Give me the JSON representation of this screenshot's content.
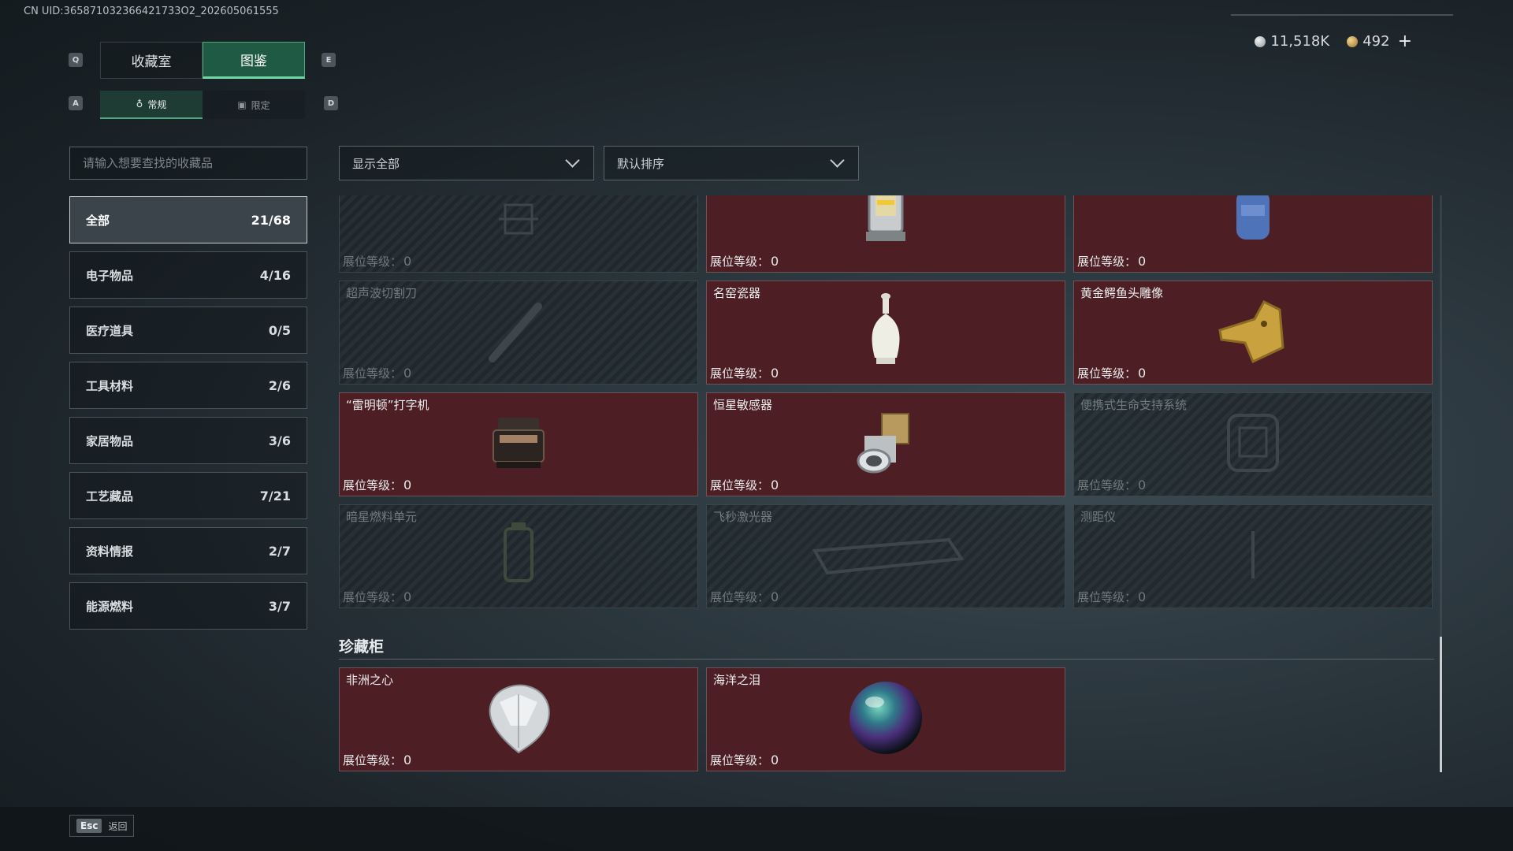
{
  "uid": "CN UID:365871032366421733O2_202605061555",
  "currency": {
    "silver": "11,518K",
    "gold": "492",
    "plus": "+"
  },
  "keys": {
    "q": "Q",
    "e": "E",
    "a": "A",
    "d": "D"
  },
  "tabs": [
    {
      "label": "收藏室",
      "active": false
    },
    {
      "label": "图鉴",
      "active": true
    }
  ],
  "subtabs": [
    {
      "label": "常规",
      "active": true
    },
    {
      "label": "限定",
      "active": false
    }
  ],
  "search": {
    "placeholder": "请输入想要查找的收藏品"
  },
  "filters": {
    "show": "显示全部",
    "sort": "默认排序"
  },
  "categories": [
    {
      "label": "全部",
      "count": "21/68",
      "active": true
    },
    {
      "label": "电子物品",
      "count": "4/16",
      "active": false
    },
    {
      "label": "医疗道具",
      "count": "0/5",
      "active": false
    },
    {
      "label": "工具材料",
      "count": "2/6",
      "active": false
    },
    {
      "label": "家居物品",
      "count": "3/6",
      "active": false
    },
    {
      "label": "工艺藏品",
      "count": "7/21",
      "active": false
    },
    {
      "label": "资料情报",
      "count": "2/7",
      "active": false
    },
    {
      "label": "能源燃料",
      "count": "3/7",
      "active": false
    }
  ],
  "level_label": "展位等级：",
  "items": [
    {
      "name": "",
      "level": "0",
      "unlocked": false,
      "icon": "partial-item-icon"
    },
    {
      "name": "",
      "level": "0",
      "unlocked": true,
      "icon": "lantern-icon"
    },
    {
      "name": "",
      "level": "0",
      "unlocked": true,
      "icon": "gas-canister-icon"
    },
    {
      "name": "超声波切割刀",
      "level": "0",
      "unlocked": false,
      "icon": "ultrasonic-knife-icon"
    },
    {
      "name": "名窑瓷器",
      "level": "0",
      "unlocked": true,
      "icon": "porcelain-vase-icon"
    },
    {
      "name": "黄金鳄鱼头雕像",
      "level": "0",
      "unlocked": true,
      "icon": "golden-crocodile-icon"
    },
    {
      "name": "“雷明顿”打字机",
      "level": "0",
      "unlocked": true,
      "icon": "typewriter-icon"
    },
    {
      "name": "恒星敏感器",
      "level": "0",
      "unlocked": true,
      "icon": "star-sensor-icon"
    },
    {
      "name": "便携式生命支持系统",
      "level": "0",
      "unlocked": false,
      "icon": "life-support-icon"
    },
    {
      "name": "暗星燃料单元",
      "level": "0",
      "unlocked": false,
      "icon": "fuel-cell-icon"
    },
    {
      "name": "飞秒激光器",
      "level": "0",
      "unlocked": false,
      "icon": "laser-icon"
    },
    {
      "name": "测距仪",
      "level": "0",
      "unlocked": false,
      "icon": "rangefinder-icon"
    }
  ],
  "treasure": {
    "title": "珍藏柜",
    "items": [
      {
        "name": "非洲之心",
        "level": "0",
        "unlocked": true,
        "icon": "diamond-icon"
      },
      {
        "name": "海洋之泪",
        "level": "0",
        "unlocked": true,
        "icon": "pearl-orb-icon"
      }
    ]
  },
  "footer": {
    "key": "Esc",
    "label": "返回"
  },
  "colors": {
    "accent": "#4ea981",
    "card_unlocked": "#4d1e24",
    "card_locked": "#283035"
  }
}
